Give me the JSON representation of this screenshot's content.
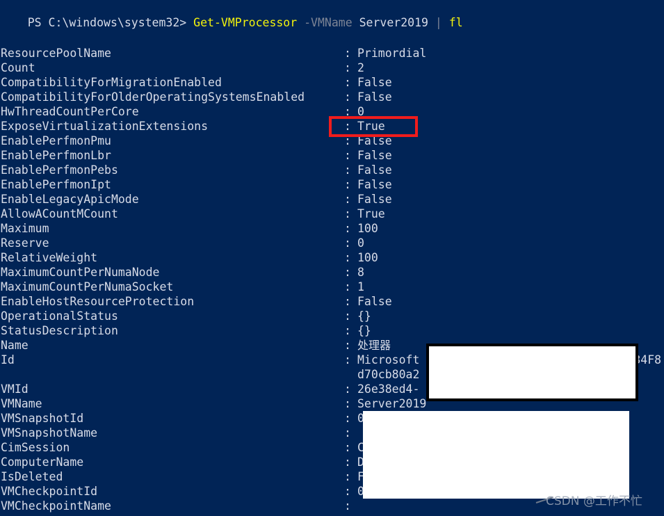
{
  "terminal": {
    "background_color": "#012456",
    "foreground_color": "#d8dce8",
    "accent_command_color": "#f2f20d",
    "dim_color": "#7c8495"
  },
  "prompt": {
    "prefix": "PS C:\\windows\\system32> ",
    "command": "Get-VMProcessor",
    "space1": " ",
    "parameter": "-VMName",
    "space2": " ",
    "argument": "Server2019",
    "space3": " ",
    "pipe": "|",
    "space4": " ",
    "format": "fl"
  },
  "properties": [
    {
      "key": "ResourcePoolName",
      "value": "Primordial"
    },
    {
      "key": "Count",
      "value": "2"
    },
    {
      "key": "CompatibilityForMigrationEnabled",
      "value": "False"
    },
    {
      "key": "CompatibilityForOlderOperatingSystemsEnabled",
      "value": "False"
    },
    {
      "key": "HwThreadCountPerCore",
      "value": "0"
    },
    {
      "key": "ExposeVirtualizationExtensions",
      "value": "True"
    },
    {
      "key": "EnablePerfmonPmu",
      "value": "False"
    },
    {
      "key": "EnablePerfmonLbr",
      "value": "False"
    },
    {
      "key": "EnablePerfmonPebs",
      "value": "False"
    },
    {
      "key": "EnablePerfmonIpt",
      "value": "False"
    },
    {
      "key": "EnableLegacyApicMode",
      "value": "False"
    },
    {
      "key": "AllowACountMCount",
      "value": "True"
    },
    {
      "key": "Maximum",
      "value": "100"
    },
    {
      "key": "Reserve",
      "value": "0"
    },
    {
      "key": "RelativeWeight",
      "value": "100"
    },
    {
      "key": "MaximumCountPerNumaNode",
      "value": "8"
    },
    {
      "key": "MaximumCountPerNumaSocket",
      "value": "1"
    },
    {
      "key": "EnableHostResourceProtection",
      "value": "False"
    },
    {
      "key": "OperationalStatus",
      "value": "{}"
    },
    {
      "key": "StatusDescription",
      "value": "{}"
    },
    {
      "key": "Name",
      "value": "处理器",
      "cjk": true
    },
    {
      "key": "Id",
      "value": "Microsoft                               34F8"
    },
    {
      "key": "",
      "value": "d70cb80a2",
      "continuation": true
    },
    {
      "key": "VMId",
      "value": "26e38ed4-"
    },
    {
      "key": "VMName",
      "value": "Server2019"
    },
    {
      "key": "VMSnapshotId",
      "value": "0                                     0"
    },
    {
      "key": "VMSnapshotName",
      "value": ""
    },
    {
      "key": "CimSession",
      "value": "C"
    },
    {
      "key": "ComputerName",
      "value": "D"
    },
    {
      "key": "IsDeleted",
      "value": "F"
    },
    {
      "key": "VMCheckpointId",
      "value": "0                                     0"
    },
    {
      "key": "VMCheckpointName",
      "value": ""
    }
  ],
  "annotations": {
    "highlight_box": {
      "name": "expose-virtualization-extensions-highlight",
      "color": "#f01c1c",
      "target_property": "ExposeVirtualizationExtensions",
      "target_value": "True"
    },
    "redaction_box_upper": {
      "name": "id-redaction",
      "fill": "#ffffff",
      "border": "#000000"
    },
    "redaction_box_lower": {
      "name": "vm-details-redaction",
      "fill": "#ffffff"
    }
  },
  "watermark": {
    "text": "CSDN @工作不忙"
  }
}
